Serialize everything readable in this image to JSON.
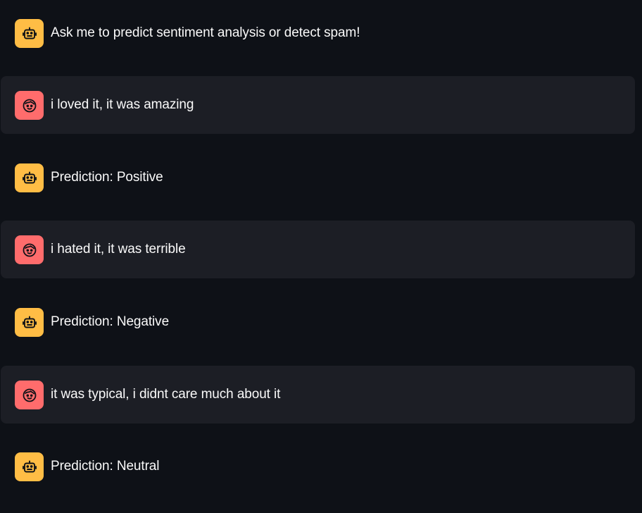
{
  "messages": [
    {
      "role": "assistant",
      "avatar_icon": "robot-icon",
      "text": "Ask me to predict sentiment analysis or detect spam!"
    },
    {
      "role": "user",
      "avatar_icon": "smiley-face-icon",
      "text": "i loved it, it was amazing"
    },
    {
      "role": "assistant",
      "avatar_icon": "robot-icon",
      "text": "Prediction: Positive"
    },
    {
      "role": "user",
      "avatar_icon": "smiley-face-icon",
      "text": "i hated it, it was terrible"
    },
    {
      "role": "assistant",
      "avatar_icon": "robot-icon",
      "text": "Prediction: Negative"
    },
    {
      "role": "user",
      "avatar_icon": "smiley-face-icon",
      "text": "it was typical, i didnt care much about it"
    },
    {
      "role": "assistant",
      "avatar_icon": "robot-icon",
      "text": "Prediction: Neutral"
    }
  ],
  "colors": {
    "background": "#0e1117",
    "user_bubble": "#1c1e25",
    "assistant_avatar": "#ffbd45",
    "user_avatar": "#ff6c6c",
    "text": "#fafafa"
  }
}
